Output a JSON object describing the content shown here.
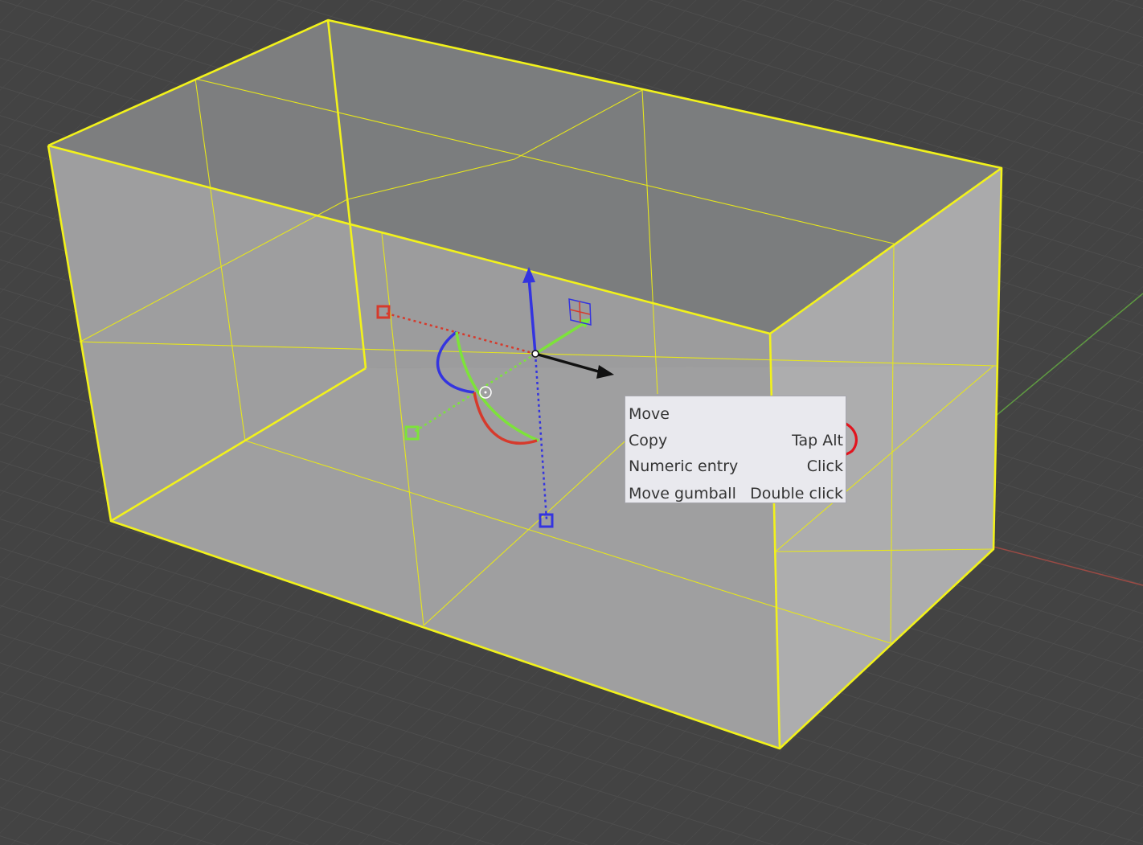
{
  "colors": {
    "background": "#434343",
    "grid_line": "#4d4d4d",
    "selection_outline": "#f2f21b",
    "x_axis": "#d63a2c",
    "y_axis": "#7de33a",
    "z_axis": "#3434e0",
    "annotation_circle": "#e2141e"
  },
  "icons": {
    "gumball_origin": "circle-dot-icon",
    "scale_handle": "square-handle-icon",
    "plane_handle": "grid-square-icon",
    "arrow": "arrow-icon"
  },
  "tooltip": {
    "rows": [
      {
        "action": "Move",
        "shortcut": ""
      },
      {
        "action": "Copy",
        "shortcut": "Tap Alt"
      },
      {
        "action": "Numeric entry",
        "shortcut": "Click"
      },
      {
        "action": "Move gumball",
        "shortcut": "Double click"
      }
    ]
  }
}
